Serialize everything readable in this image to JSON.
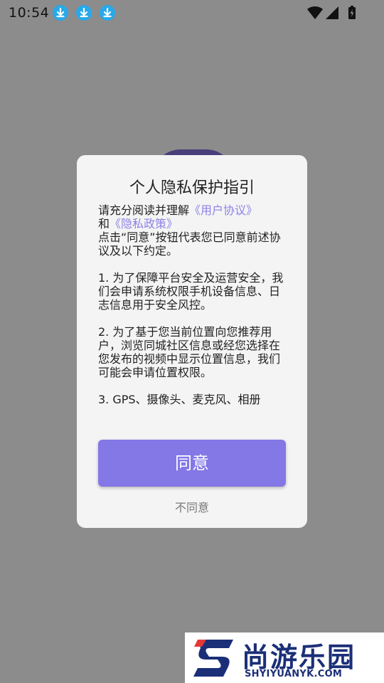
{
  "status_bar": {
    "time": "10:54",
    "icons": [
      "download-icon",
      "download-icon",
      "download-icon",
      "wifi-icon",
      "signal-icon",
      "battery-icon"
    ]
  },
  "dialog": {
    "title": "个人隐私保护指引",
    "intro_prefix": "请充分阅读并理解",
    "link_user_agreement": "《用户协议》",
    "and": "和",
    "link_privacy_policy": "《隐私政策》",
    "intro_suffix": "点击“同意”按钮代表您已同意前述协议及以下约定。",
    "item1": "1. 为了保障平台安全及运营安全，我们会申请系统权限手机设备信息、日志信息用于安全风控。",
    "item2": "2. 为了基于您当前位置向您推荐用户，浏览同城社区信息或经您选择在您发布的视频中显示位置信息，我们可能会申请位置权限。",
    "item3_partial": "3. GPS、摄像头、麦克风、相册",
    "agree_label": "同意",
    "disagree_label": "不同意"
  },
  "colors": {
    "accent": "#8477e6",
    "link": "#8d82e8"
  },
  "watermark": {
    "brand": "尚游乐园",
    "url": "SHYIYUANYK.COM"
  }
}
